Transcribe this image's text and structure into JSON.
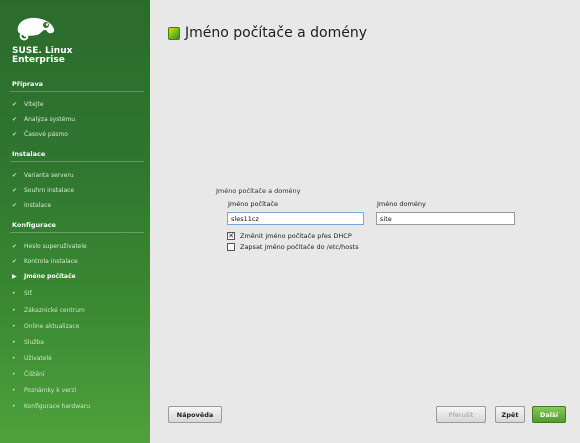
{
  "brand": {
    "line1": "SUSE. Linux",
    "line2": "Enterprise"
  },
  "sidebar": {
    "sections": [
      {
        "title": "Příprava",
        "steps": [
          {
            "label": "Vítejte",
            "state": "done"
          },
          {
            "label": "Analýza systému",
            "state": "done"
          },
          {
            "label": "Časové pásmo",
            "state": "done"
          }
        ]
      },
      {
        "title": "Instalace",
        "steps": [
          {
            "label": "Varianta serveru",
            "state": "done"
          },
          {
            "label": "Souhrn instalace",
            "state": "done"
          },
          {
            "label": "Instalace",
            "state": "done"
          }
        ]
      },
      {
        "title": "Konfigurace",
        "steps": [
          {
            "label": "Heslo superuživatele",
            "state": "done"
          },
          {
            "label": "Kontrola instalace",
            "state": "done"
          },
          {
            "label": "Jméno počítače",
            "state": "current"
          },
          {
            "label": "Síť",
            "state": "todo"
          },
          {
            "label": "Zákaznické centrum",
            "state": "todo"
          },
          {
            "label": "Online aktualizace",
            "state": "todo"
          },
          {
            "label": "Služba",
            "state": "todo"
          },
          {
            "label": "Uživatelé",
            "state": "todo"
          },
          {
            "label": "Čištění",
            "state": "todo"
          },
          {
            "label": "Poznámky k verzi",
            "state": "todo"
          },
          {
            "label": "Konfigurace hardwaru",
            "state": "todo"
          }
        ]
      }
    ]
  },
  "main": {
    "title": "Jméno počítače a domény",
    "group_label": "Jméno počítače a domény",
    "hostname": {
      "label": "Jméno počítače",
      "value": "sles11cz"
    },
    "domain": {
      "label": "Jméno domény",
      "value": "site"
    },
    "dhcp_checkbox": {
      "label": "Změnit jméno počítače přes DHCP",
      "checked": true,
      "mark": "✕"
    },
    "hosts_checkbox": {
      "label": "Zapsat jméno počítače do /etc/hosts",
      "checked": false,
      "mark": ""
    }
  },
  "buttons": {
    "help": "Nápověda",
    "abort": "Přerušit",
    "back": "Zpět",
    "next": "Další"
  },
  "colors": {
    "sidebar_green": "#2f7530",
    "accent_green": "#4f9b2c"
  }
}
